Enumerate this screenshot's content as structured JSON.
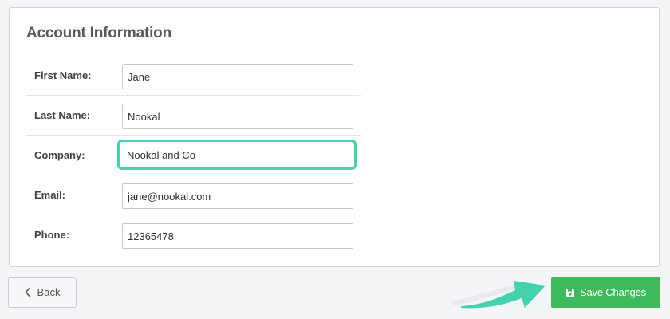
{
  "panel": {
    "title": "Account Information"
  },
  "form": {
    "fields": [
      {
        "label": "First Name:",
        "value": "Jane"
      },
      {
        "label": "Last Name:",
        "value": "Nookal"
      },
      {
        "label": "Company:",
        "value": "Nookal and Co"
      },
      {
        "label": "Email:",
        "value": "jane@nookal.com"
      },
      {
        "label": "Phone:",
        "value": "12365478"
      }
    ]
  },
  "actions": {
    "back_label": "Back",
    "save_label": "Save Changes",
    "back_icon": "chevron-left-icon",
    "save_icon": "floppy-disk-icon"
  },
  "colors": {
    "save_button": "#3dba5b",
    "highlight": "#45d3ae",
    "annotation_arrow": "#45d3ae"
  }
}
